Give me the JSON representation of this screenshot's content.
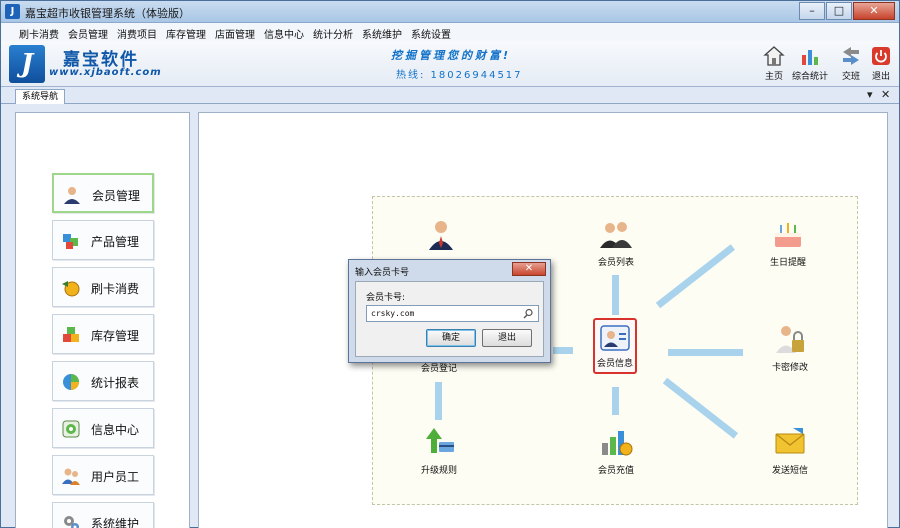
{
  "window": {
    "title": "嘉宝超市收银管理系统（体验版）"
  },
  "menu": [
    "刷卡消费",
    "会员管理",
    "消费项目",
    "库存管理",
    "店面管理",
    "信息中心",
    "统计分析",
    "系统维护",
    "系统设置"
  ],
  "banner": {
    "logo_name": "嘉宝软件",
    "logo_url": "www.xjbaoft.com",
    "slogan": "挖掘管理您的财富!",
    "hotline": "热线: 18026944517"
  },
  "toolbar": {
    "home": "主页",
    "stats": "综合统计",
    "handover": "交班",
    "exit": "退出"
  },
  "nav_tab": {
    "label": "系统导航"
  },
  "nav": [
    "会员管理",
    "产品管理",
    "刷卡消费",
    "库存管理",
    "统计报表",
    "信息中心",
    "用户员工",
    "系统维护"
  ],
  "flow": {
    "member_list": "会员列表",
    "member_register": "会员登记",
    "member_info": "会员信息",
    "birthday": "生日提醒",
    "card_password": "卡密修改",
    "upgrade_rule": "升级规则",
    "recharge": "会员充值",
    "send_sms": "发送短信"
  },
  "dialog": {
    "title": "输入会员卡号",
    "label": "会员卡号:",
    "value": "crsky.com",
    "ok": "确定",
    "cancel": "退出"
  }
}
